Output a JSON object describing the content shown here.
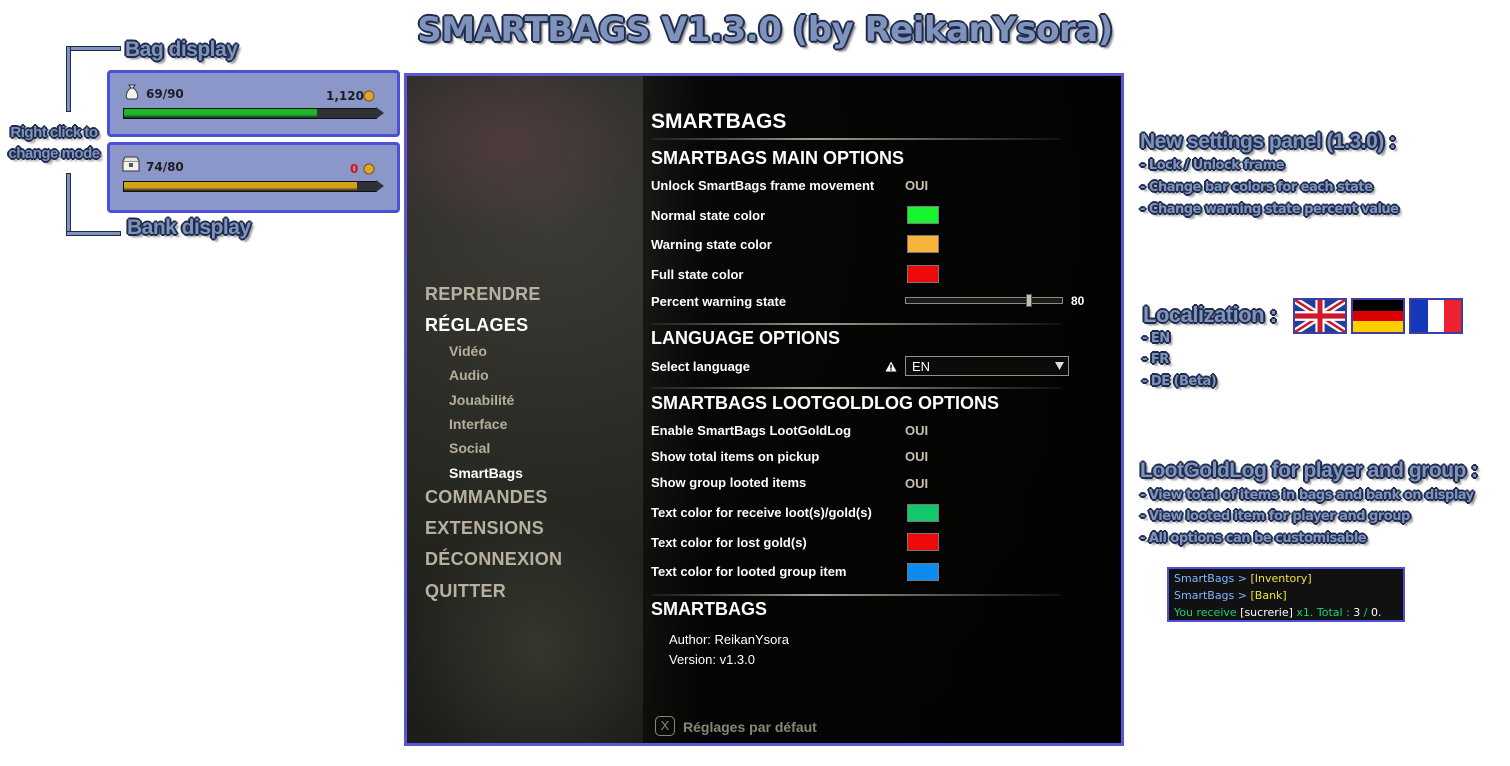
{
  "title": "SMARTBAGS V1.3.0 (by ReikanYsora)",
  "annotations": {
    "bag_display": "Bag display",
    "right_click": [
      "Right click to",
      "change mode"
    ],
    "bank_display": "Bank display"
  },
  "bag_widget": {
    "slots": "69/90",
    "gold": "1,120",
    "fill_fraction": 0.765,
    "fill_color": "#1db82a"
  },
  "bank_widget": {
    "slots": "74/80",
    "gold": "0",
    "fill_fraction": 0.925,
    "fill_color": "#d4a21b"
  },
  "menu": {
    "items": [
      "REPRENDRE",
      "RÉGLAGES",
      "COMMANDES",
      "EXTENSIONS",
      "DÉCONNEXION",
      "QUITTER"
    ],
    "subitems": [
      "Vidéo",
      "Audio",
      "Jouabilité",
      "Interface",
      "Social",
      "SmartBags"
    ]
  },
  "options": {
    "title": "SMARTBAGS",
    "main_header": "SMARTBAGS MAIN OPTIONS",
    "unlock_label": "Unlock SmartBags frame movement",
    "unlock_value": "OUI",
    "normal_label": "Normal state color",
    "normal_color": "#16f52d",
    "warning_label": "Warning state color",
    "warning_color": "#f6b43b",
    "full_label": "Full state color",
    "full_color": "#ee0a0a",
    "percent_label": "Percent warning state",
    "percent_value": "80",
    "percent_fraction": 0.8,
    "lang_header": "LANGUAGE OPTIONS",
    "select_lang_label": "Select language",
    "select_lang_value": "EN",
    "lootlog_header": "SMARTBAGS LOOTGOLDLOG OPTIONS",
    "enable_label": "Enable SmartBags LootGoldLog",
    "enable_value": "OUI",
    "total_label": "Show total items on pickup",
    "total_value": "OUI",
    "group_label": "Show group looted items",
    "group_value": "OUI",
    "receive_label": "Text color for receive loot(s)/gold(s)",
    "receive_color": "#11c96a",
    "lost_label": "Text color for lost gold(s)",
    "lost_color": "#ee0a0a",
    "looted_group_label": "Text color for looted group item",
    "looted_group_color": "#0c8bf0",
    "about_header": "SMARTBAGS",
    "author": "Author: ReikanYsora",
    "version": "Version: v1.3.0",
    "reset_key": "X",
    "reset_label": "Réglages par défaut"
  },
  "notes": {
    "settings_title": "New settings panel (1.3.0) :",
    "settings_items": [
      "- Lock / Unlock frame",
      "- Change bar colors for each state",
      "- Change warning state percent value"
    ],
    "localization_title": "Localization :",
    "localization_items": [
      "- EN",
      "- FR",
      "- DE (Beta)"
    ],
    "lootlog_title": "LootGoldLog for player and group :",
    "lootlog_items": [
      "- View total of items in bags and bank on display",
      "- View looted item for player and group",
      "- All options can be customisable"
    ]
  },
  "chat": {
    "line1_prefix": "SmartBags > ",
    "line1_tag": "[Inventory]",
    "line2_prefix": "SmartBags > ",
    "line2_tag": "[Bank]",
    "line3_a": "You receive ",
    "line3_item": "[sucrerie]",
    "line3_b": " x1. Total : ",
    "line3_n1": "3",
    "line3_sep": " / ",
    "line3_n2": "0."
  }
}
